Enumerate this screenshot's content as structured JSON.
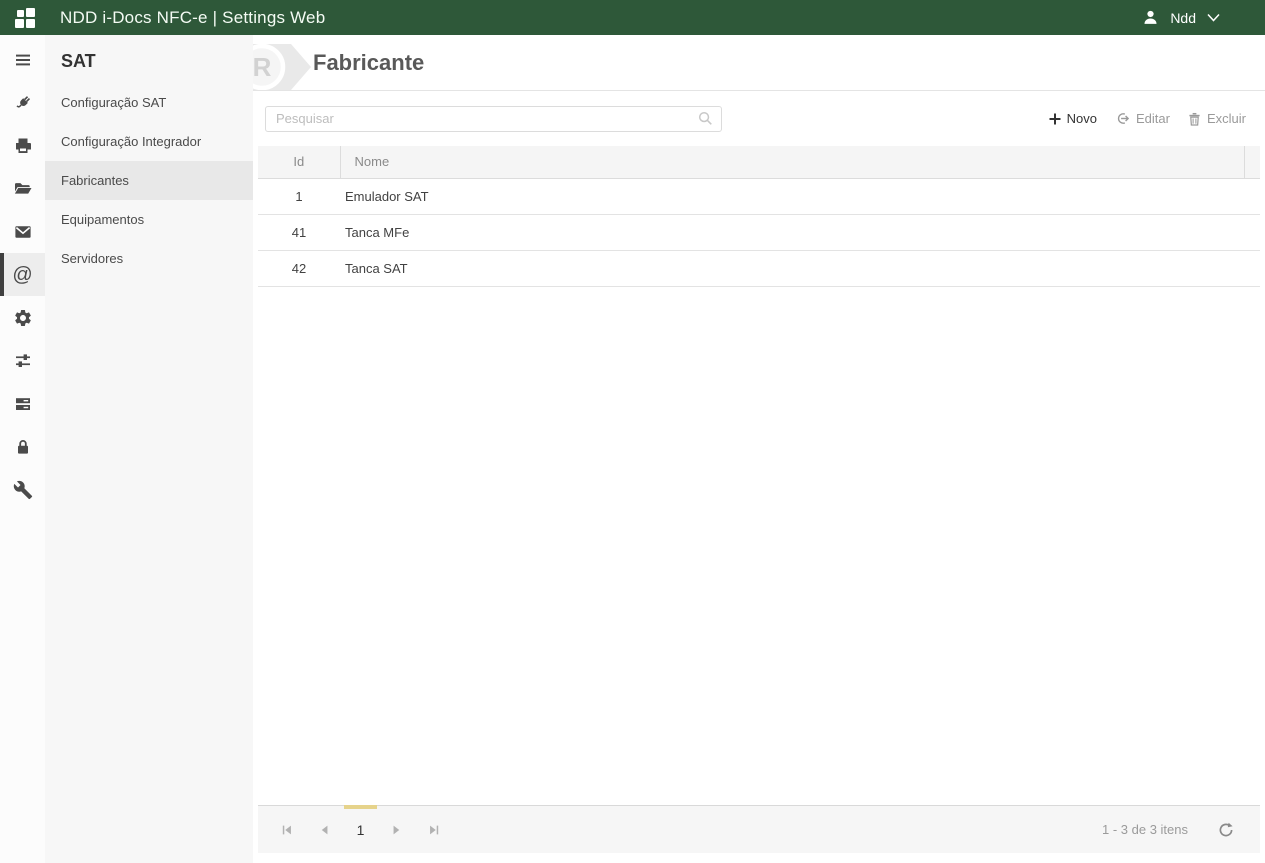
{
  "app": {
    "title": "NDD i-Docs NFC-e | Settings Web",
    "user_name": "Ndd"
  },
  "icon_rail": {
    "items": [
      "menu",
      "plug",
      "printer",
      "folder-open",
      "envelope",
      "at-sign",
      "gear",
      "sliders",
      "server",
      "lock",
      "wrench"
    ],
    "active_item": "at-sign"
  },
  "sidebar": {
    "title": "SAT",
    "items": [
      {
        "label": "Configuração SAT",
        "active": false
      },
      {
        "label": "Configuração Integrador",
        "active": false
      },
      {
        "label": "Fabricantes",
        "active": true
      },
      {
        "label": "Equipamentos",
        "active": false
      },
      {
        "label": "Servidores",
        "active": false
      }
    ]
  },
  "page": {
    "title": "Fabricante",
    "watermark_letter": "R"
  },
  "toolbar": {
    "search_placeholder": "Pesquisar",
    "novo_label": "Novo",
    "editar_label": "Editar",
    "excluir_label": "Excluir"
  },
  "grid": {
    "columns": {
      "id": "Id",
      "nome": "Nome"
    },
    "rows": [
      {
        "id": "1",
        "nome": "Emulador SAT"
      },
      {
        "id": "41",
        "nome": "Tanca MFe"
      },
      {
        "id": "42",
        "nome": "Tanca SAT"
      }
    ]
  },
  "pager": {
    "current_page": "1",
    "info": "1 - 3 de 3 itens"
  },
  "colors": {
    "header_green": "#2e5839",
    "accent_yellow": "#e6d38b",
    "active_rail_border": "#3f3f3f"
  }
}
